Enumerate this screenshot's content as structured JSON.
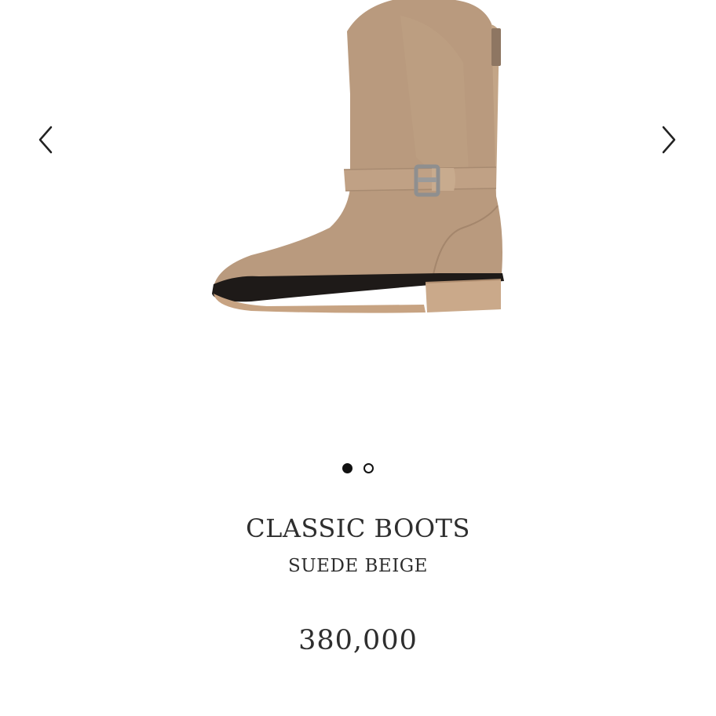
{
  "gallery": {
    "prev_icon": "chevron-left-icon",
    "next_icon": "chevron-right-icon",
    "image_subject": "beige suede mid-calf boot with buckle strap",
    "colors": {
      "suede": "#b99a7e",
      "sole_dark": "#1e1a18",
      "heel": "#caa98a"
    },
    "dots": [
      {
        "active": true
      },
      {
        "active": false
      }
    ]
  },
  "product": {
    "name": "CLASSIC BOOTS",
    "variant": "SUEDE BEIGE",
    "price": "380,000"
  }
}
